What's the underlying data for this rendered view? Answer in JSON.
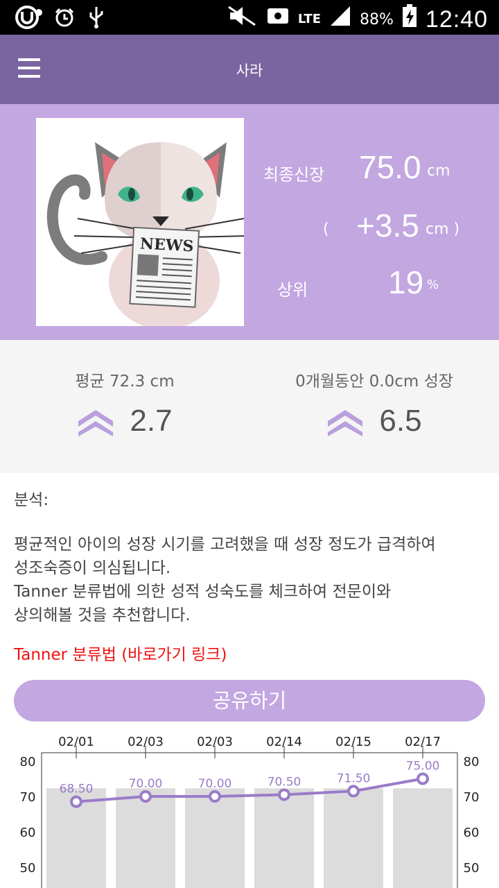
{
  "status_bar": {
    "battery_percent": "88%",
    "time": "12:40",
    "network": "LTE"
  },
  "appbar": {
    "title": "사라"
  },
  "hero": {
    "avatar_icon": "cat-newspaper-icon",
    "avatar_text": "NEWS",
    "final_height_label": "최종신장",
    "final_height_value": "75.0",
    "final_height_unit": "cm",
    "diff_open": "(",
    "diff_value": "+3.5",
    "diff_unit": "cm )",
    "rank_label": "상위",
    "rank_value": "19",
    "rank_unit": "%"
  },
  "summary": {
    "left_caption": "평균 72.3 cm",
    "left_value": "2.7",
    "right_caption": "0개월동안 0.0cm 성장",
    "right_value": "6.5"
  },
  "analysis": {
    "heading": "분석:",
    "line1": "평균적인 아이의 성장 시기를 고려했을 때 성장 정도가 급격하여",
    "line2": "성조숙증이 의심됩니다.",
    "line3": "Tanner 분류법에 의한 성적 성숙도를 체크하여 전문이와",
    "line4": "상의해볼 것을 추천합니다."
  },
  "link_text": "Tanner 분류법 (바로가기 링크)",
  "share_label": "공유하기",
  "colors": {
    "appbar": "#7a65a0",
    "hero": "#c2a7e1",
    "accent": "#9a7cc8",
    "link": "#ee1111"
  },
  "chart_data": {
    "type": "bar",
    "categories": [
      "02/01",
      "02/03",
      "02/03",
      "02/14",
      "02/15",
      "02/17"
    ],
    "series": [
      {
        "values": [
          72.3,
          72.3,
          72.3,
          72.3,
          72.3,
          72.3
        ]
      },
      {
        "values": [
          68.5,
          70.0,
          70.0,
          70.5,
          71.5,
          75.0
        ]
      }
    ],
    "bar_labels": [
      "72.30",
      "72.30",
      "72.30",
      "72.30",
      "72.30",
      "72.30"
    ],
    "line_labels": [
      "68.50",
      "70.00",
      "70.00",
      "70.50",
      "71.50",
      "75.00"
    ],
    "yticks": [
      "80",
      "70",
      "60",
      "50"
    ],
    "ylim": [
      45,
      80
    ],
    "grid": false
  }
}
